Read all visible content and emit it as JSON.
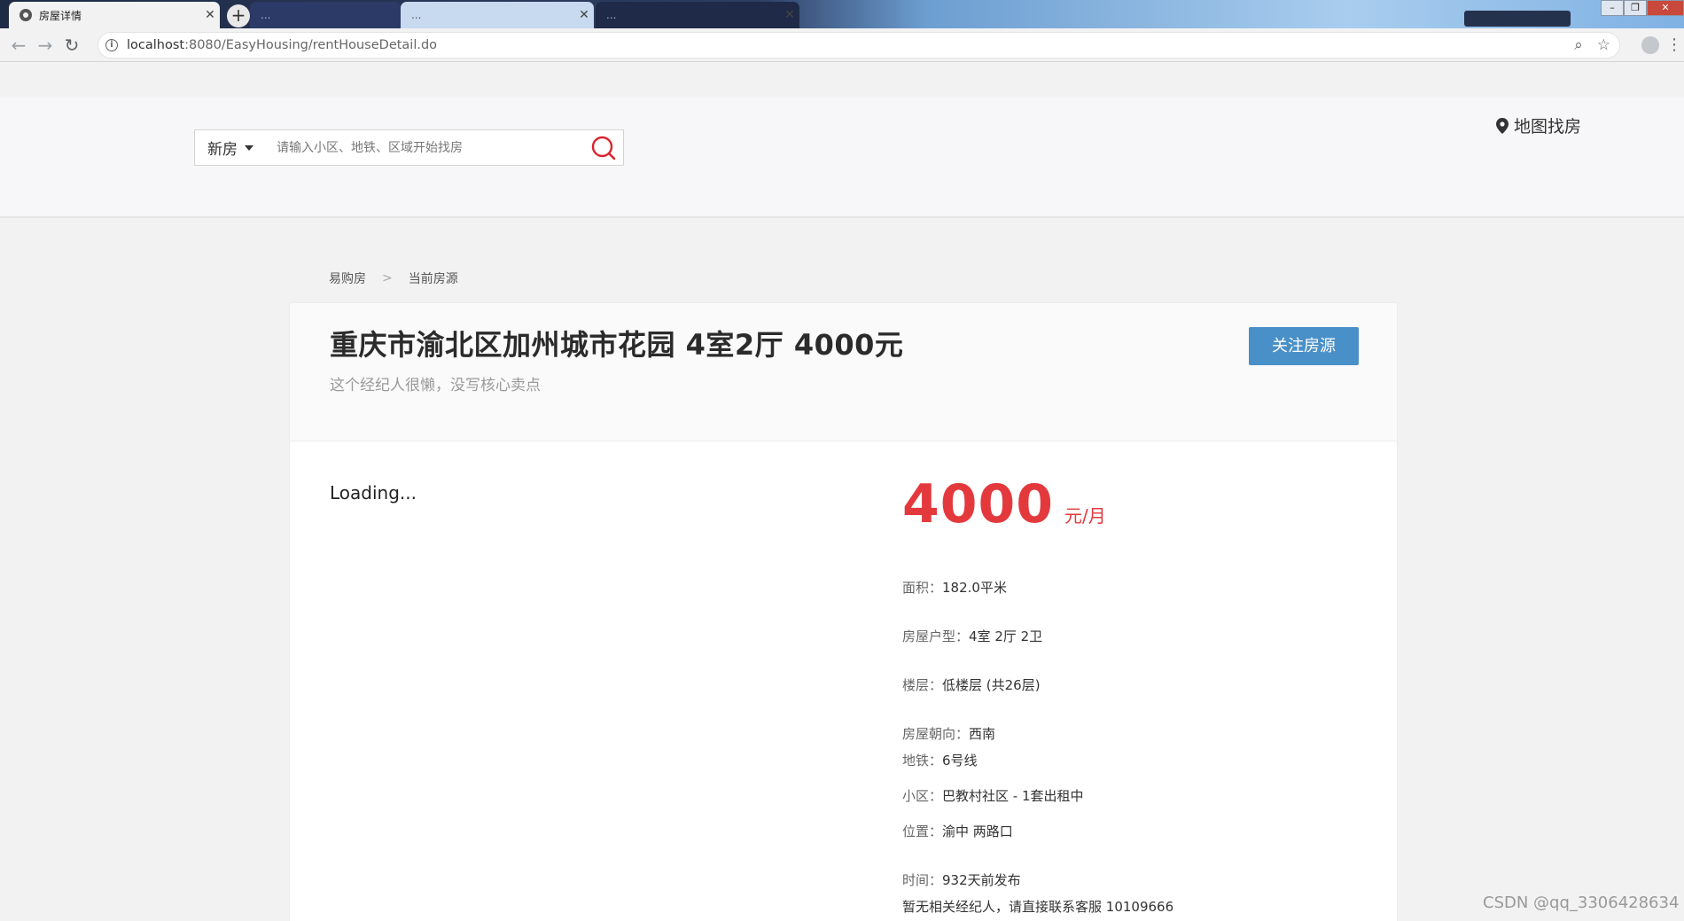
{
  "browser": {
    "active_tab_title": "房屋详情",
    "bg_tab_1": "...",
    "bg_tab_2": "...",
    "bg_tab_3": "...",
    "url_host": "localhost",
    "url_rest": ":8080/EasyHousing/rentHouseDetail.do"
  },
  "header": {
    "search_type": "新房",
    "search_placeholder": "请输入小区、地铁、区域开始找房",
    "map_link": "地图找房"
  },
  "breadcrumb": {
    "home": "易购房",
    "current": "当前房源"
  },
  "house": {
    "title": "重庆市渝北区加州城市花园 4室2厅 4000元",
    "subtitle": "这个经纪人很懒，没写核心卖点",
    "follow_button": "关注房源",
    "loading_text": "Loading...",
    "price": "4000",
    "price_unit": "元/月",
    "details": [
      {
        "key": "面积：",
        "value": "182.0平米"
      },
      {
        "key": "房屋户型：",
        "value": "4室 2厅 2卫"
      },
      {
        "key": "楼层：",
        "value": "低楼层 (共26层)"
      },
      {
        "key": "房屋朝向：",
        "value": "西南"
      },
      {
        "key": "地铁：",
        "value": "6号线"
      },
      {
        "key": "小区：",
        "value": "巴教村社区 - 1套出租中"
      },
      {
        "key": "位置：",
        "value": "渝中 两路口"
      },
      {
        "key": "时间：",
        "value": "932天前发布"
      }
    ],
    "contact_note": "暂无相关经纪人，请直接联系客服 10109666"
  },
  "watermark": "CSDN @qq_3306428634",
  "colors": {
    "price_red": "#e4393c",
    "button_blue": "#4a90c8",
    "search_icon_red": "#d9232e"
  }
}
